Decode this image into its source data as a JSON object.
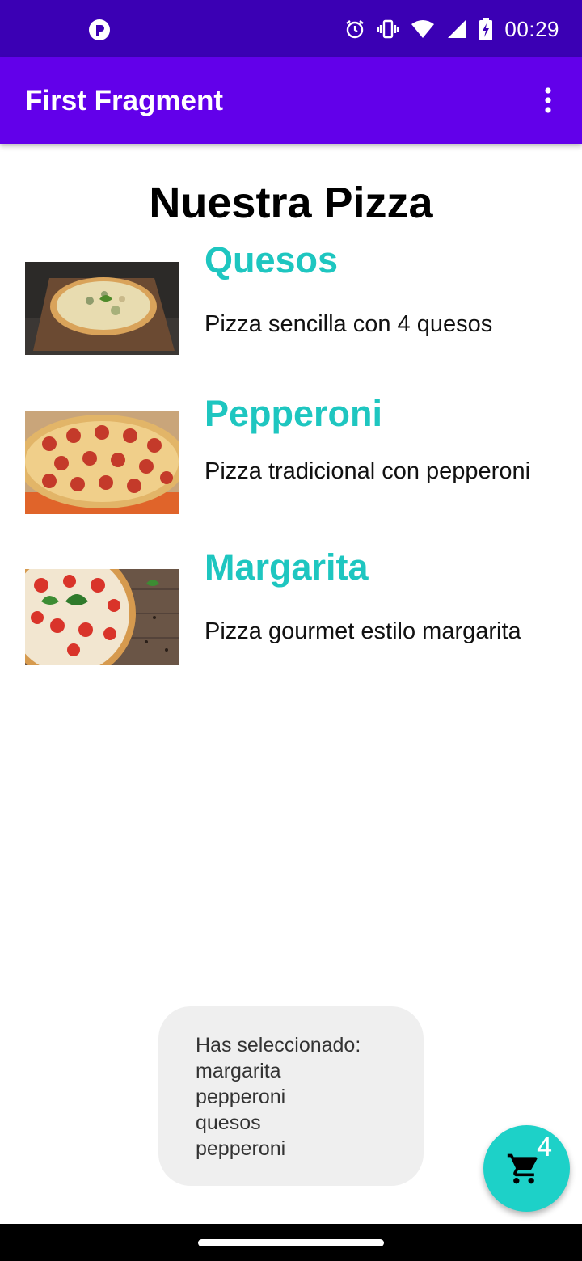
{
  "status_bar": {
    "time": "00:29",
    "bg_color": "#3b00b4",
    "icons": [
      "app-notification-icon",
      "alarm-icon",
      "vibrate-icon",
      "wifi-icon",
      "signal-icon",
      "battery-charging-icon"
    ]
  },
  "app_bar": {
    "title": "First Fragment",
    "bg_color": "#6200ea",
    "menu_icon": "overflow-menu-icon"
  },
  "main": {
    "title": "Nuestra Pizza",
    "accent_color": "#1ec6c0",
    "pizzas": [
      {
        "name": "Quesos",
        "description": "Pizza sencilla con 4 quesos"
      },
      {
        "name": "Pepperoni",
        "description": "Pizza tradicional con pepperoni"
      },
      {
        "name": "Margarita",
        "description": "Pizza gourmet estilo margarita"
      }
    ]
  },
  "toast": {
    "lines": [
      "Has seleccionado:",
      "margarita",
      "pepperoni",
      "quesos",
      "pepperoni"
    ]
  },
  "fab": {
    "icon": "cart-icon",
    "count": "4",
    "color": "#1dd1c8"
  }
}
